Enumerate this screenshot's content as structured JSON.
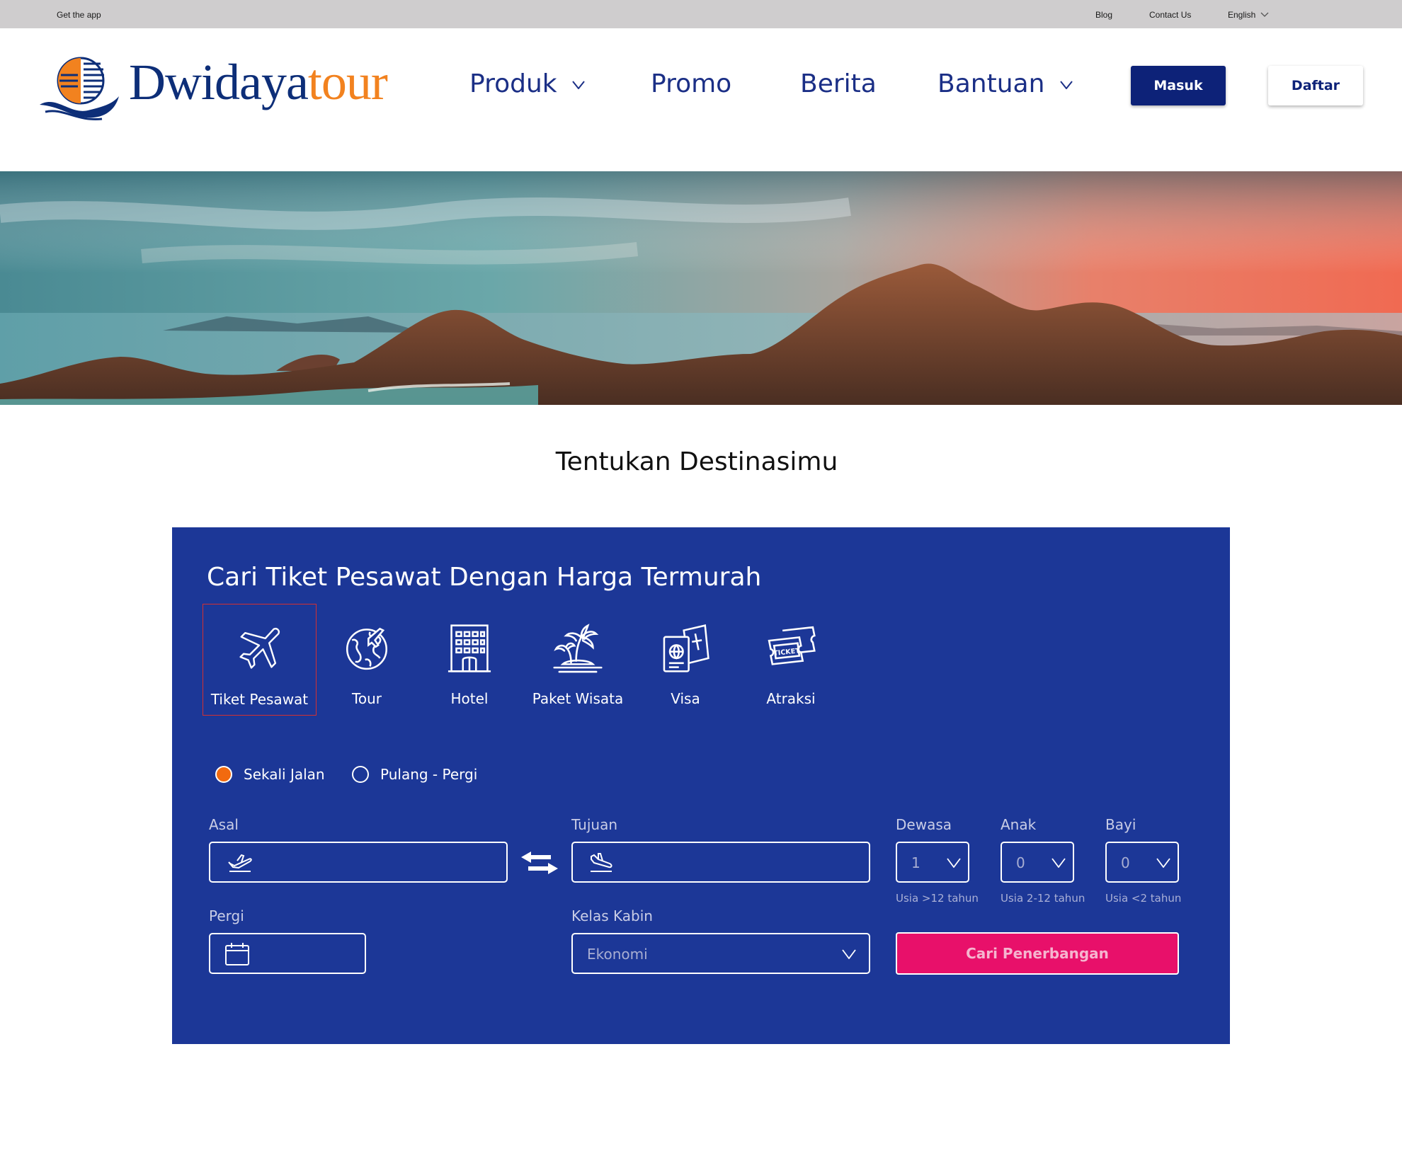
{
  "topbar": {
    "get_app": "Get the app",
    "blog": "Blog",
    "contact": "Contact Us",
    "language": "English"
  },
  "brand": {
    "part1": "Dwidaya",
    "part2": "tour",
    "color_primary": "#0d2e78",
    "color_accent": "#f2821f"
  },
  "nav": {
    "produk": "Produk",
    "promo": "Promo",
    "berita": "Berita",
    "bantuan": "Bantuan"
  },
  "auth": {
    "masuk": "Masuk",
    "daftar": "Daftar"
  },
  "page_title": "Tentukan Destinasimu",
  "search": {
    "title": "Cari Tiket Pesawat Dengan Harga Termurah",
    "categories": [
      {
        "label": "Tiket Pesawat",
        "icon": "airplane-icon",
        "active": true
      },
      {
        "label": "Tour",
        "icon": "globe-icon"
      },
      {
        "label": "Hotel",
        "icon": "hotel-icon"
      },
      {
        "label": "Paket Wisata",
        "icon": "island-icon"
      },
      {
        "label": "Visa",
        "icon": "passport-icon"
      },
      {
        "label": "Atraksi",
        "icon": "ticket-icon"
      }
    ],
    "ticket_text": "TICKET",
    "trip_types": [
      {
        "label": "Sekali Jalan",
        "selected": true
      },
      {
        "label": "Pulang - Pergi",
        "selected": false
      }
    ],
    "labels": {
      "asal": "Asal",
      "tujuan": "Tujuan",
      "dewasa": "Dewasa",
      "anak": "Anak",
      "bayi": "Bayi",
      "pergi": "Pergi",
      "kelas": "Kelas Kabin"
    },
    "values": {
      "asal": "",
      "tujuan": "",
      "dewasa": "1",
      "anak": "0",
      "bayi": "0",
      "pergi": "",
      "kelas": "Ekonomi"
    },
    "hints": {
      "dewasa": "Usia >12 tahun",
      "anak": "Usia 2-12 tahun",
      "bayi": "Usia <2 tahun"
    },
    "submit": "Cari Penerbangan",
    "colors": {
      "panel": "#1c3797",
      "submit": "#e8106a",
      "radio_selected": "#f26a0f"
    }
  }
}
